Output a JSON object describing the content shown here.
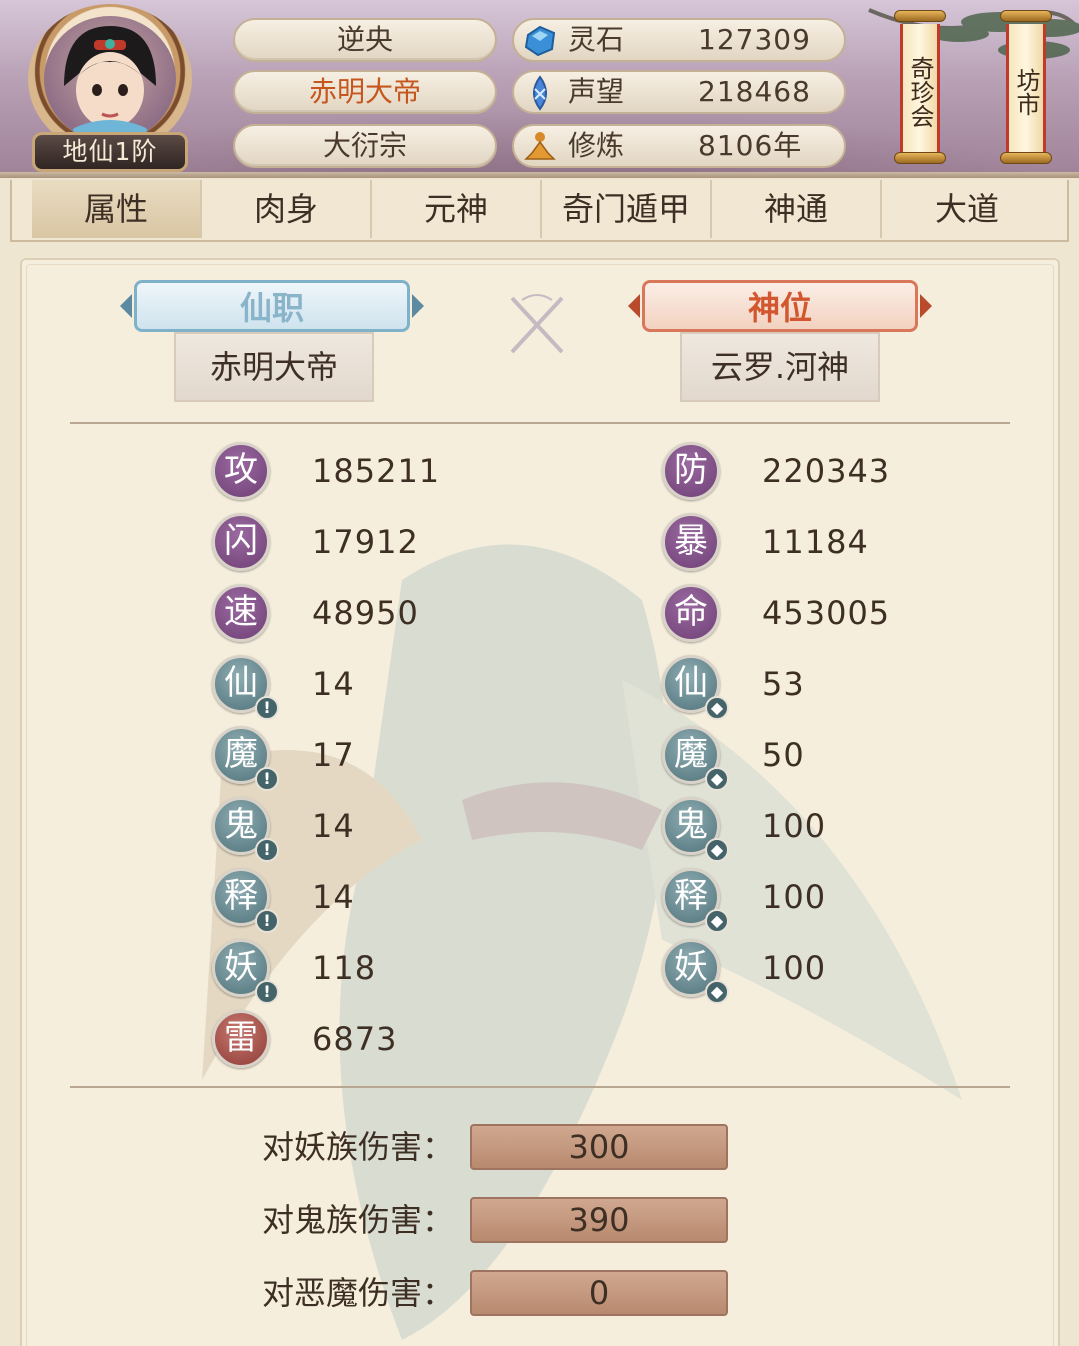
{
  "header": {
    "realm_label": "地仙1阶",
    "names": [
      "逆央",
      "赤明大帝",
      "大衍宗"
    ],
    "resources": [
      {
        "icon": "spirit-stone-icon",
        "label": "灵石",
        "value": "127309"
      },
      {
        "icon": "prestige-icon",
        "label": "声望",
        "value": "218468"
      },
      {
        "icon": "cultivation-icon",
        "label": "修炼",
        "value": "8106年"
      }
    ],
    "scroll_buttons": [
      "奇珍会",
      "坊市"
    ]
  },
  "tabs": [
    "属性",
    "肉身",
    "元神",
    "奇门遁甲",
    "神通",
    "大道"
  ],
  "titles": {
    "immortal_post": {
      "banner": "仙职",
      "value": "赤明大帝"
    },
    "divine_rank": {
      "banner": "神位",
      "value": "云罗.河神"
    }
  },
  "stats_left": [
    {
      "glyph": "攻",
      "value": "185211",
      "badge": "purple"
    },
    {
      "glyph": "闪",
      "value": "17912",
      "badge": "purple"
    },
    {
      "glyph": "速",
      "value": "48950",
      "badge": "purple"
    },
    {
      "glyph": "仙",
      "value": "14",
      "badge": "teal",
      "sub": "!"
    },
    {
      "glyph": "魔",
      "value": "17",
      "badge": "teal",
      "sub": "!"
    },
    {
      "glyph": "鬼",
      "value": "14",
      "badge": "teal",
      "sub": "!"
    },
    {
      "glyph": "释",
      "value": "14",
      "badge": "teal",
      "sub": "!"
    },
    {
      "glyph": "妖",
      "value": "118",
      "badge": "teal",
      "sub": "!"
    },
    {
      "glyph": "雷",
      "value": "6873",
      "badge": "red"
    }
  ],
  "stats_right": [
    {
      "glyph": "防",
      "value": "220343",
      "badge": "purple"
    },
    {
      "glyph": "暴",
      "value": "11184",
      "badge": "purple"
    },
    {
      "glyph": "命",
      "value": "453005",
      "badge": "purple"
    },
    {
      "glyph": "仙",
      "value": "53",
      "badge": "teal",
      "sub": "shield"
    },
    {
      "glyph": "魔",
      "value": "50",
      "badge": "teal",
      "sub": "shield"
    },
    {
      "glyph": "鬼",
      "value": "100",
      "badge": "teal",
      "sub": "shield"
    },
    {
      "glyph": "释",
      "value": "100",
      "badge": "teal",
      "sub": "shield"
    },
    {
      "glyph": "妖",
      "value": "100",
      "badge": "teal",
      "sub": "shield"
    }
  ],
  "damage": [
    {
      "label": "对妖族伤害：",
      "value": "300"
    },
    {
      "label": "对鬼族伤害：",
      "value": "390"
    },
    {
      "label": "对恶魔伤害：",
      "value": "0"
    }
  ],
  "colors": {
    "accent_red": "#c5561e",
    "badge_purple": "#6e3f76",
    "badge_teal": "#4f7278",
    "badge_red": "#8e3b36",
    "damage_bar": "#b88a6f"
  }
}
